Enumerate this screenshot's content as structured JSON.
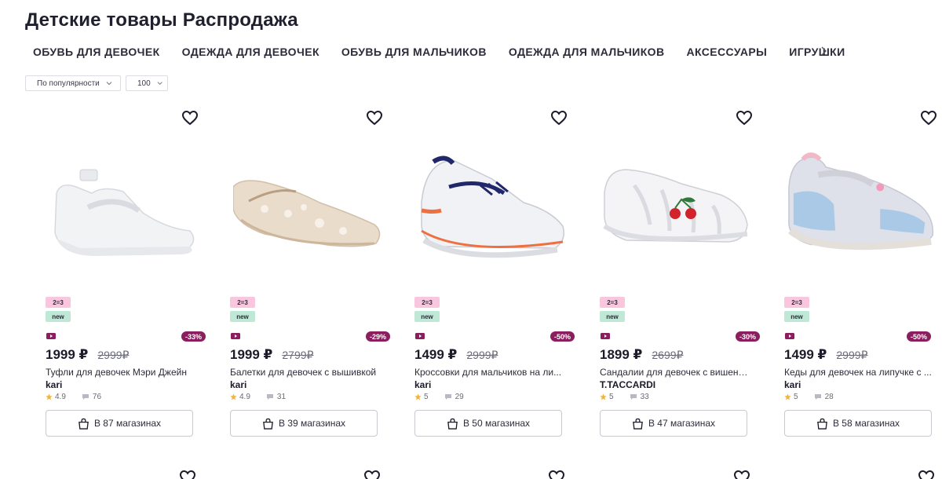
{
  "title": "Детские товары Распродажа",
  "categories": [
    "ОБУВЬ ДЛЯ ДЕВОЧЕК",
    "ОДЕЖДА ДЛЯ ДЕВОЧЕК",
    "ОБУВЬ ДЛЯ МАЛЬЧИКОВ",
    "ОДЕЖДА ДЛЯ МАЛЬЧИКОВ",
    "АКСЕССУАРЫ",
    "ИГРУШКИ"
  ],
  "sort": {
    "value": "По популярности"
  },
  "per_page": {
    "value": "100"
  },
  "badges": {
    "promo": "2=3",
    "new": "new"
  },
  "products": [
    {
      "price": "1999 ₽",
      "old_price": "2999₽",
      "discount": "-33%",
      "name": "Туфли для девочек Мэри Джейн",
      "brand": "kari",
      "rating": "4.9",
      "reviews": "76",
      "stores": "В 87 магазинах",
      "icon": "shoe-image-white-maryjane"
    },
    {
      "price": "1999 ₽",
      "old_price": "2799₽",
      "discount": "-29%",
      "name": "Балетки для девочек с вышивкой",
      "brand": "kari",
      "rating": "4.9",
      "reviews": "31",
      "stores": "В 39 магазинах",
      "icon": "shoe-image-beige-ballet"
    },
    {
      "price": "1499 ₽",
      "old_price": "2999₽",
      "discount": "-50%",
      "name": "Кроссовки для мальчиков на ли...",
      "brand": "kari",
      "rating": "5",
      "reviews": "29",
      "stores": "В 50 магазинах",
      "icon": "shoe-image-sneaker"
    },
    {
      "price": "1899 ₽",
      "old_price": "2699₽",
      "discount": "-30%",
      "name": "Сандалии для девочек с вишенк...",
      "brand": "T.TACCARDI",
      "rating": "5",
      "reviews": "33",
      "stores": "В 47 магазинах",
      "icon": "shoe-image-sandal"
    },
    {
      "price": "1499 ₽",
      "old_price": "2999₽",
      "discount": "-50%",
      "name": "Кеды для девочек на липучке с ...",
      "brand": "kari",
      "rating": "5",
      "reviews": "28",
      "stores": "В 58 магазинах",
      "icon": "shoe-image-pastel-sneaker"
    }
  ],
  "colors": {
    "discount": "#8c1d5e",
    "promo_badge": "#f9c6de",
    "new_badge": "#bfe9d6",
    "star": "#f2b33d"
  }
}
